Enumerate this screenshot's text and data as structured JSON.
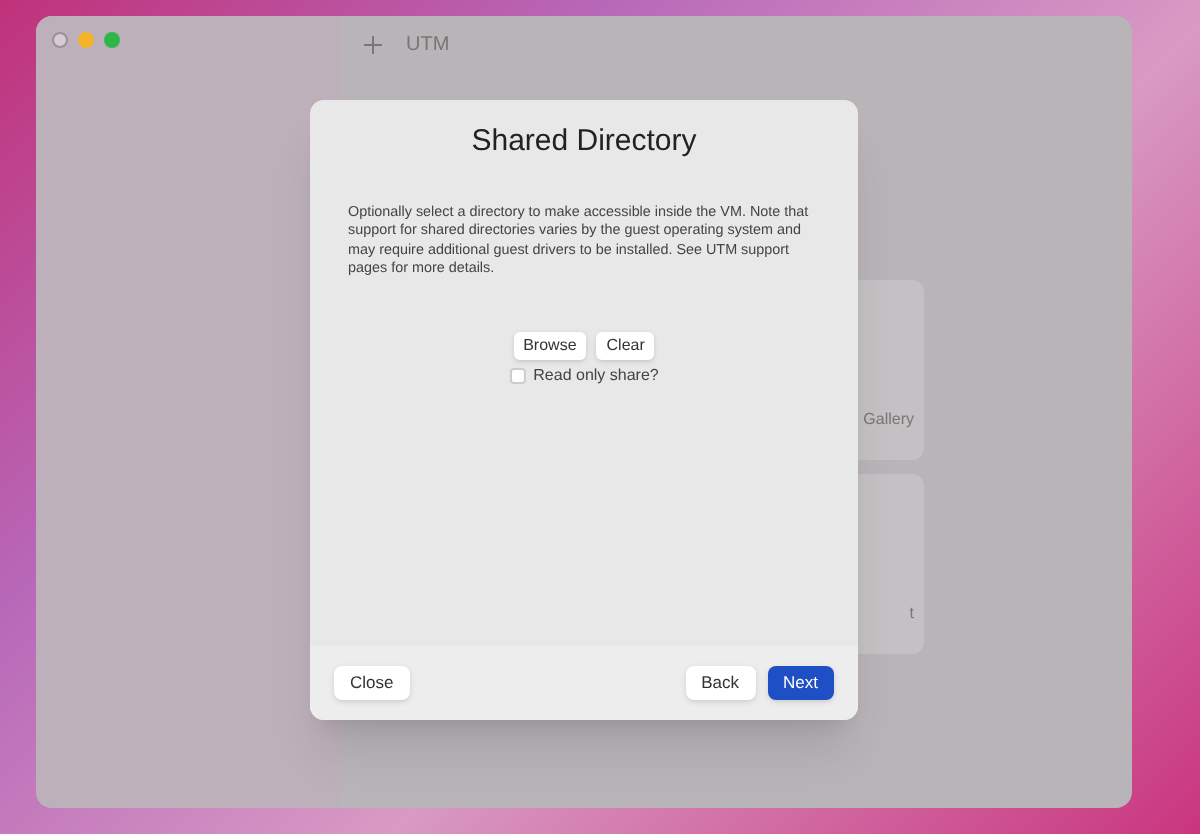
{
  "window": {
    "title": "UTM"
  },
  "background_cards": [
    {
      "label": "Gallery"
    },
    {
      "label": "t"
    }
  ],
  "dialog": {
    "title": "Shared Directory",
    "description": "Optionally select a directory to make accessible inside the VM. Note that support for shared directories varies by the guest operating system and may require additional guest drivers to be installed. See UTM support pages for more details.",
    "buttons": [
      "Browse",
      "Clear"
    ],
    "read_only": {
      "label": "Read only share?",
      "checked": false
    },
    "footer": [
      {
        "label": "Close",
        "primary": false
      },
      {
        "label": "Back",
        "primary": false
      },
      {
        "label": "Next",
        "primary": true
      }
    ]
  }
}
